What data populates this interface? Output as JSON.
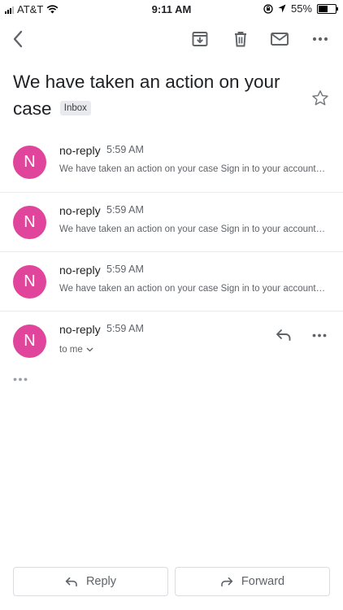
{
  "status_bar": {
    "carrier": "AT&T",
    "time": "9:11 AM",
    "battery": "55%",
    "battery_level": 0.55
  },
  "toolbar": {
    "back_icon": "chevron-left-icon",
    "archive_icon": "archive-icon",
    "delete_icon": "trash-icon",
    "mark_icon": "mail-icon",
    "more_icon": "more-horizontal-icon"
  },
  "subject": {
    "text": "We have taken an action on your case",
    "label": "Inbox"
  },
  "messages": [
    {
      "avatar": "N",
      "sender": "no-reply",
      "time": "5:59 AM",
      "snippet": "We have taken an action on your case Sign in to your account to view the details"
    },
    {
      "avatar": "N",
      "sender": "no-reply",
      "time": "5:59 AM",
      "snippet": "We have taken an action on your case Sign in to your account to view the details"
    },
    {
      "avatar": "N",
      "sender": "no-reply",
      "time": "5:59 AM",
      "snippet": "We have taken an action on your case Sign in to your account to view the details"
    }
  ],
  "expanded_message": {
    "avatar": "N",
    "sender": "no-reply",
    "time": "5:59 AM",
    "recipient": "to me"
  },
  "bottom_actions": {
    "reply": "Reply",
    "forward": "Forward"
  },
  "colors": {
    "avatar": "#e0459b",
    "icon": "#5f6368"
  }
}
